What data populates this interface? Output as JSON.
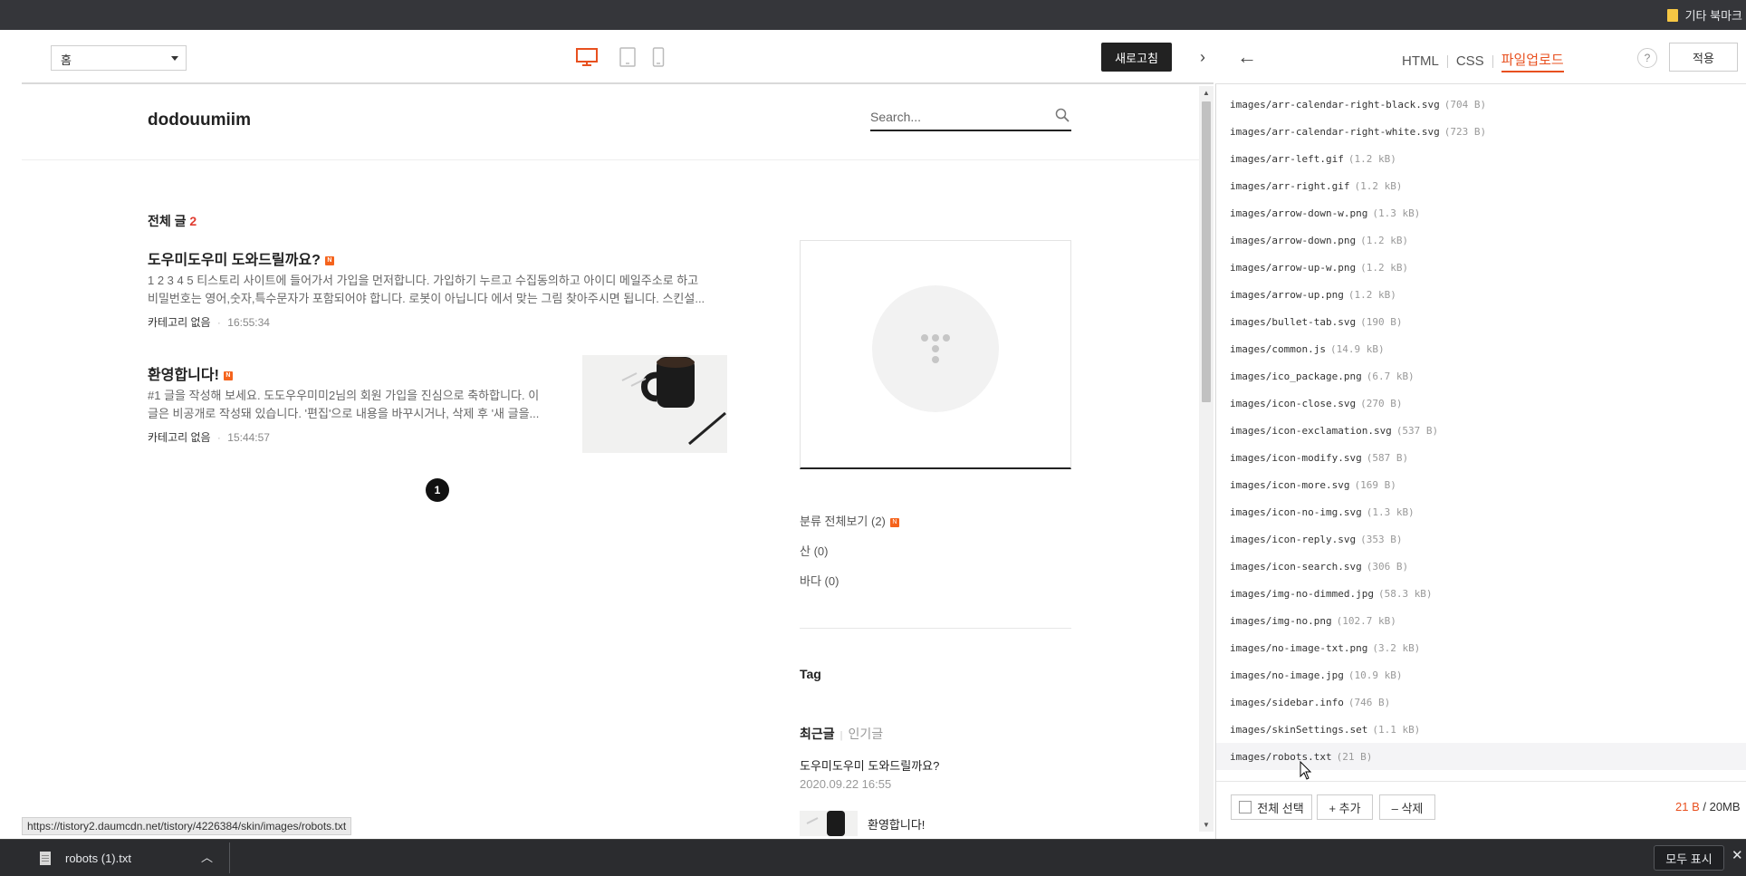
{
  "browser": {
    "bookmark_folder": "기타 북마크"
  },
  "preview_toolbar": {
    "page_select_value": "홈",
    "devices": [
      "desktop-icon",
      "tablet-icon",
      "mobile-icon"
    ],
    "refresh_label": "새로고침",
    "accent": "#e8501f"
  },
  "blog": {
    "title": "dodouumiim",
    "search_placeholder": "Search...",
    "count_label": "전체 글",
    "count_value": "2",
    "posts": [
      {
        "title": "도우미도우미 도와드릴까요?",
        "badge": "N",
        "excerpt": "1 2 3 4 5 티스토리 사이트에 들어가서 가입을 먼저합니다. 가입하기 누르고 수집동의하고 아이디 메일주소로 하고 비밀번호는 영어,숫자,특수문자가 포함되어야 합니다. 로봇이 아닙니다 에서 맞는 그림 찾아주시면 됩니다. 스킨설...",
        "category": "카테고리 없음",
        "time": "16:55:34"
      },
      {
        "title": "환영합니다!",
        "badge": "N",
        "excerpt": "#1 글을 작성해 보세요. 도도우우미미2님의 회원 가입을 진심으로 축하합니다. 이 글은 비공개로 작성돼 있습니다. '편집'으로 내용을 바꾸시거나, 삭제 후 '새 글을...",
        "category": "카테고리 없음",
        "time": "15:44:57"
      }
    ],
    "pager_current": "1",
    "sidebar": {
      "categories": [
        {
          "label": "분류 전체보기 (2)",
          "badge": "N"
        },
        {
          "label": "산 (0)"
        },
        {
          "label": "바다 (0)"
        }
      ],
      "tag_title": "Tag",
      "recent_tab_active": "최근글",
      "recent_tab_inactive": "인기글",
      "recent_posts": [
        {
          "title": "도우미도우미 도와드릴까요?",
          "date": "2020.09.22 16:55"
        },
        {
          "title": "환영합니다!"
        }
      ]
    }
  },
  "status_url": "https://tistory2.daumcdn.net/tistory/4226384/skin/images/robots.txt",
  "editor": {
    "tabs": [
      {
        "label": "HTML"
      },
      {
        "label": "CSS"
      },
      {
        "label": "파일업로드",
        "active": true
      }
    ],
    "help_label": "?",
    "apply_label": "적용",
    "files": [
      {
        "name": "images/arr-calendar-right-black.svg",
        "size": "(704 B)"
      },
      {
        "name": "images/arr-calendar-right-white.svg",
        "size": "(723 B)"
      },
      {
        "name": "images/arr-left.gif",
        "size": "(1.2 kB)"
      },
      {
        "name": "images/arr-right.gif",
        "size": "(1.2 kB)"
      },
      {
        "name": "images/arrow-down-w.png",
        "size": "(1.3 kB)"
      },
      {
        "name": "images/arrow-down.png",
        "size": "(1.2 kB)"
      },
      {
        "name": "images/arrow-up-w.png",
        "size": "(1.2 kB)"
      },
      {
        "name": "images/arrow-up.png",
        "size": "(1.2 kB)"
      },
      {
        "name": "images/bullet-tab.svg",
        "size": "(190 B)"
      },
      {
        "name": "images/common.js",
        "size": "(14.9 kB)"
      },
      {
        "name": "images/ico_package.png",
        "size": "(6.7 kB)"
      },
      {
        "name": "images/icon-close.svg",
        "size": "(270 B)"
      },
      {
        "name": "images/icon-exclamation.svg",
        "size": "(537 B)"
      },
      {
        "name": "images/icon-modify.svg",
        "size": "(587 B)"
      },
      {
        "name": "images/icon-more.svg",
        "size": "(169 B)"
      },
      {
        "name": "images/icon-no-img.svg",
        "size": "(1.3 kB)"
      },
      {
        "name": "images/icon-reply.svg",
        "size": "(353 B)"
      },
      {
        "name": "images/icon-search.svg",
        "size": "(306 B)"
      },
      {
        "name": "images/img-no-dimmed.jpg",
        "size": "(58.3 kB)"
      },
      {
        "name": "images/img-no.png",
        "size": "(102.7 kB)"
      },
      {
        "name": "images/no-image-txt.png",
        "size": "(3.2 kB)"
      },
      {
        "name": "images/no-image.jpg",
        "size": "(10.9 kB)"
      },
      {
        "name": "images/sidebar.info",
        "size": "(746 B)"
      },
      {
        "name": "images/skinSettings.set",
        "size": "(1.1 kB)"
      },
      {
        "name": "images/robots.txt",
        "size": "(21 B)",
        "selected": true
      }
    ],
    "select_all_label": "전체 선택",
    "add_label": "+ 추가",
    "delete_label": "– 삭제",
    "quota_used": "21 B",
    "quota_total": "/ 20MB"
  },
  "downloads": {
    "file": "robots (1).txt",
    "show_all_label": "모두 표시"
  }
}
